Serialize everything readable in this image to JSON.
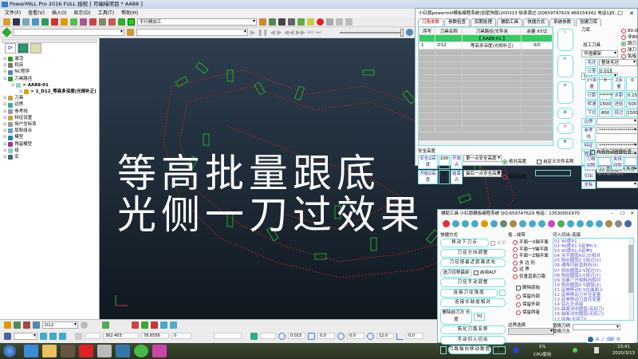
{
  "window": {
    "title": "PowerMILL Pro 2016 FULL 授权   [ 可编缉项目 * AA88 ]"
  },
  "menu": [
    "文件(F)",
    "查看(V)",
    "插入(I)",
    "显示(D)",
    "工具(T)",
    "帮助(H)"
  ],
  "toolbar": {
    "strategy_combo": "平行精加工"
  },
  "explorer": {
    "tree": [
      {
        "label": "激活",
        "color": "#2a9a2a",
        "indent": 0
      },
      {
        "label": "机床",
        "color": "#777",
        "indent": 0
      },
      {
        "label": "NC程序",
        "color": "#4a8ac0",
        "indent": 0
      },
      {
        "label": "刀具路径",
        "color": "#2a9a2a",
        "indent": 0
      },
      {
        "label": "> AA88-01",
        "color": "#9cc",
        "indent": 1
      },
      {
        "label": "> 1_D12_等高多深度(光侧补正)",
        "color": "#d4a017",
        "indent": 2
      },
      {
        "label": "刀具",
        "color": "#c8a040",
        "indent": 0
      },
      {
        "label": "边界",
        "color": "#3aa",
        "indent": 0
      },
      {
        "label": "参考线",
        "color": "#999",
        "indent": 0
      },
      {
        "label": "特征设置",
        "color": "#c8a040",
        "indent": 0
      },
      {
        "label": "用户坐标系",
        "color": "#999",
        "indent": 0
      },
      {
        "label": "层和组合",
        "color": "#5aa0d0",
        "indent": 0
      },
      {
        "label": "模型",
        "color": "#1a8a9a",
        "indent": 0
      },
      {
        "label": "残留模型",
        "color": "#a030a0",
        "indent": 0
      },
      {
        "label": "组",
        "color": "#8cc",
        "indent": 0
      },
      {
        "label": "宏",
        "color": "#467",
        "indent": 0
      }
    ]
  },
  "overlay": {
    "line1": "等高批量跟底",
    "line2": "光侧一刀过效果"
  },
  "status_bar": {
    "tool": "D12",
    "x": "362.403",
    "y": "78.6556",
    "z": "0",
    "tolerance": "0.015",
    "thickness": "0.0",
    "axial": "0.0",
    "diameter": "12.0",
    "angle": "0.0"
  },
  "taskbar": {
    "cpu_percent": "1%",
    "cpu_label": "CPU使用",
    "time": "13:41",
    "date": "2020/3/13"
  },
  "top_panel": {
    "title": "小红旗powermill模板编程系统(加密狗版)200313  徐承源过 QQ659747629 469154342 电话135...",
    "tabs": [
      "刀路参数",
      "参数检查",
      "后期处理",
      "辅助工具",
      "快捷方式",
      "系统参数",
      "创建刀库"
    ],
    "columns": [
      "序号",
      "刀具名称",
      "刀具路径/文件夹",
      "余量 XY/Z"
    ],
    "rows": [
      [
        "",
        "",
        "【 AA88-01 】",
        ""
      ],
      [
        "1",
        "D12",
        "等高多深度(光侧补正)",
        "0/0"
      ]
    ],
    "tool_library_label": "刀库",
    "tool_library": "华逸模架",
    "machining_tool_label": "加工刀具",
    "machining_tool": "D12",
    "tool_types": [
      {
        "label": "80.0圆鼻刀",
        "on": false
      },
      {
        "label": "非80.0圆鼻刀",
        "on": false
      },
      {
        "label": "跳刀",
        "on": true
      },
      {
        "label": "球刀",
        "on": false
      },
      {
        "label": "贴暗",
        "on": false
      }
    ],
    "params": {
      "blank_label": "毛坯",
      "blank": "整体毛坯",
      "tol_label": "公差",
      "tol": "0.015",
      "xy_label": "XY余量",
      "xy": "0",
      "z_label": "Z余量",
      "z": "0",
      "stepover_label": "行距",
      "stepover": "******",
      "stepdown_label": "步距",
      "stepdown": "0.15",
      "speed_label": "转速",
      "speed": "1500",
      "feed_label": "进给",
      "feed": "500",
      "plunge_label": "下切",
      "plunge": "800",
      "skim_label": "掠过",
      "skim": "15000"
    },
    "boundary_label": "边界",
    "ref_label": "参考线",
    "ref": "******************************",
    "feature_label": "特征",
    "feature": "******************************",
    "residual_label": "残留参数",
    "residual": "******************************",
    "leads_label": "切入切出",
    "leads": "22 直圆圆3 5角度-90",
    "coord_label": "坐标",
    "safe": {
      "title": "安全高度",
      "safe_z_label": "安全Z高度",
      "safe_z": "100",
      "start_z_label": "开始Z高度",
      "start_z": "5",
      "start_pt_label": "开始点",
      "start_pt": "第一点安全高度",
      "end_pt_label": "结束点",
      "end_pt": "最后一点安全高度",
      "abs": "绝对高度",
      "rel": "相对高度"
    },
    "custom_name": "自定义文件名称",
    "collision": "启用自动碰撞检查",
    "holder_gap": "刀柄间隙",
    "clamp_gap": "夹持间隙",
    "max_blank": "加工最大毛坯"
  },
  "aux_panel": {
    "title": "辅助工具  小红旗模板编程系统  QQ:659747629  电话：13530001970",
    "quick_title": "快捷方式",
    "buttons": [
      "移动下刀点",
      "刀径方向调整",
      "刀径按最近距离优化",
      "选刀径移最前",
      "刀径手动调整",
      "连接刀径强增",
      "连接长缺省相对",
      "删除前刀次  长度",
      "简化刀路名称",
      "手动切入切出",
      "刀路轴向移动数值"
    ],
    "close_chk": "关闭",
    "alt_chk": "启用ALT",
    "length_val": "70",
    "z_btn": "Z",
    "offset_val": "-0.45",
    "project_title": "投...成带",
    "project_opts": [
      "平面一X轴平面",
      "平面一Y轴平面",
      "平面一Z轴平面",
      "多 边 形",
      "边      界",
      "仅垂直面刀路"
    ],
    "delete_chk": "删除原始",
    "keep_opts": [
      "保留内部",
      "保留外部",
      "保留两者"
    ],
    "boundary_sel": "边界选择",
    "leads_title": "切入切出-连接",
    "leads_list": [
      "01 90度R1",
      "02 90度R1.5延伸0.5",
      "03 90度R1.5延伸1",
      "04 水平圆弧R0.25相对",
      "05 斜向圆弧0.5按过(X)",
      "06 通角切前直斜向(X)",
      "07 斜向圆弧0.5按过(Y)",
      "08 斜向圆弧0.5按过(Y)",
      "09 没量三开相斜向相对",
      "10 斜向圆弧0.5圆弧(X)",
      "11 延伸移动0.5在曲面上",
      "12 延伸移动刀半径变量",
      "13 延伸移动刀直径变量",
      "14 钻孔无连接",
      "15 曲面法向圆弧(有掠刀)",
      "16 曲面法向圆弧(无掠刀)",
      "17 掠角(无掠刀)"
    ],
    "replace_holder": "替换刀柄",
    "replace_head": "替换刀头"
  }
}
